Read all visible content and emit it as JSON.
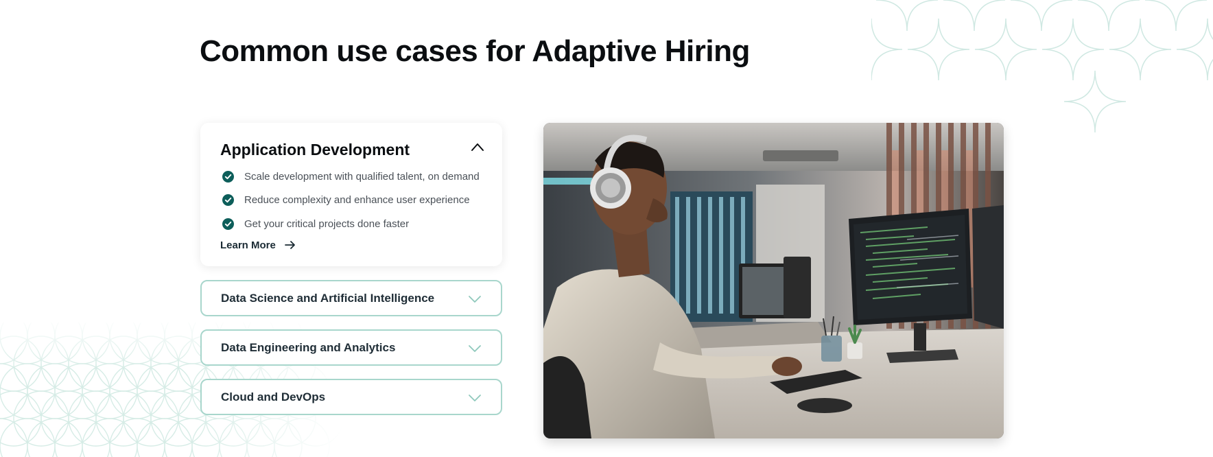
{
  "page": {
    "title": "Common use cases for Adaptive Hiring"
  },
  "accordion": {
    "open_panel": {
      "title": "Application Development",
      "bullets": [
        "Scale development with qualified talent, on demand",
        "Reduce complexity and enhance user experience",
        "Get your critical projects done faster"
      ],
      "link_label": "Learn More"
    },
    "closed_panels": [
      {
        "title": "Data Science and Artificial Intelligence"
      },
      {
        "title": "Data Engineering and Analytics"
      },
      {
        "title": "Cloud and DevOps"
      }
    ]
  },
  "colors": {
    "accent_teal": "#0d5e5a",
    "border_mint": "#a8d6cc",
    "decor_mint": "#cfe8e2"
  },
  "icons": [
    "chevron-up-icon",
    "check-circle-icon",
    "arrow-right-icon",
    "chevron-down-icon"
  ],
  "image": {
    "subject": "photo-developer-at-workstation"
  }
}
